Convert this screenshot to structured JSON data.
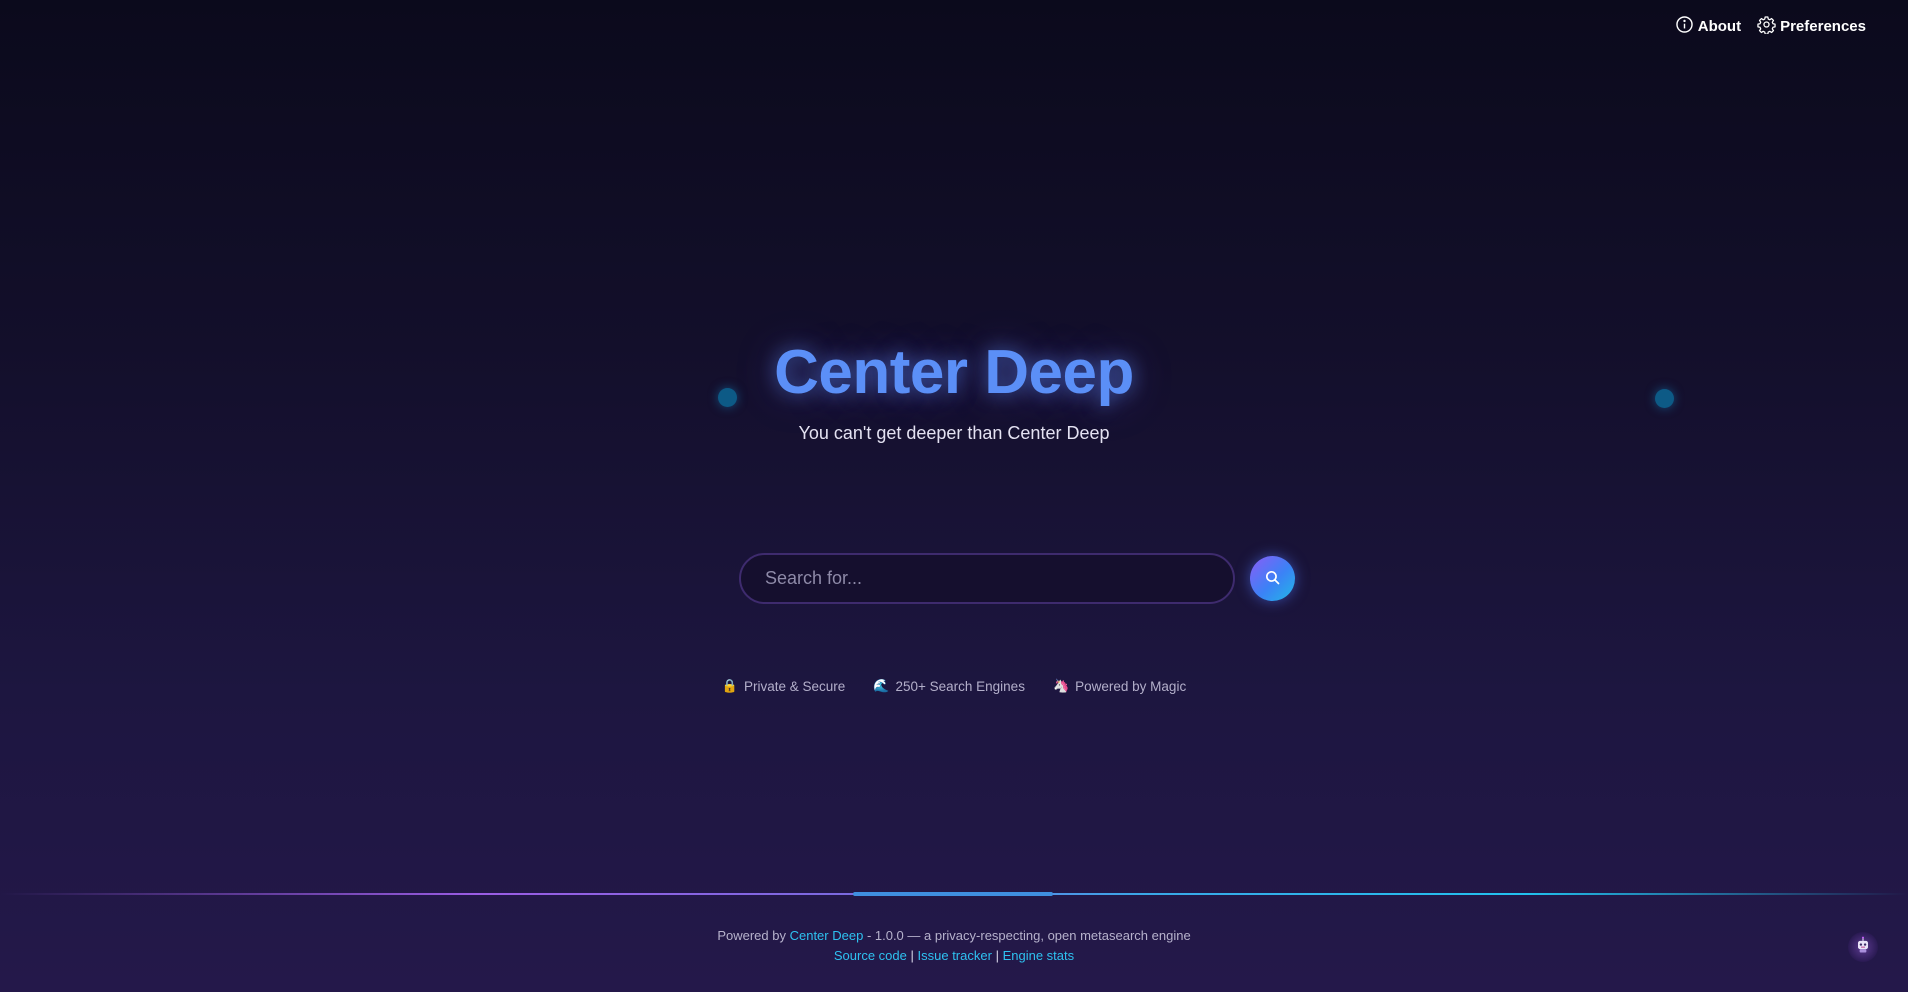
{
  "nav": {
    "about_label": "About",
    "preferences_label": "Preferences"
  },
  "hero": {
    "title": "Center Deep",
    "tagline": "You can't get deeper than Center Deep"
  },
  "search": {
    "placeholder": "Search for...",
    "value": ""
  },
  "features": [
    {
      "icon": "🔒",
      "label": "Private & Secure"
    },
    {
      "icon": "🌊",
      "label": "250+ Search Engines"
    },
    {
      "icon": "🦄",
      "label": "Powered by Magic"
    }
  ],
  "footer": {
    "powered_prefix": "Powered by",
    "brand_link": "Center Deep",
    "version_text": "- 1.0.0 — a privacy-respecting, open metasearch engine",
    "links": [
      "Source code",
      "Issue tracker",
      "Engine stats"
    ],
    "separator": "|"
  },
  "colors": {
    "accent_blue": "#5b8ff7",
    "link_cyan": "#2ec1f0",
    "search_button_gradient": [
      "#8b5cf6",
      "#3b82f6",
      "#22b8e6"
    ]
  },
  "icons": {
    "about": "info-icon",
    "preferences": "gear-icon",
    "search": "search-icon",
    "mascot": "robot-mascot-icon"
  }
}
